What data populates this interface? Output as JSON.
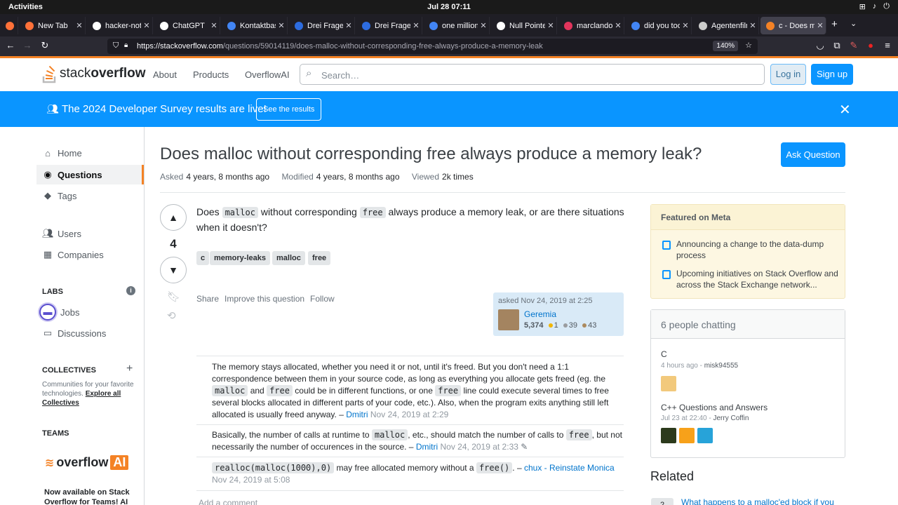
{
  "system": {
    "activities": "Activities",
    "clock": "Jul 28  07:11"
  },
  "tabs": [
    {
      "title": "",
      "color": "#ff7139"
    },
    {
      "title": "New Tab",
      "color": "#ff7139"
    },
    {
      "title": "hacker-note",
      "color": "#ffffff"
    },
    {
      "title": "ChatGPT",
      "color": "#ffffff"
    },
    {
      "title": "Kontaktbasi",
      "color": "#4285f4"
    },
    {
      "title": "Drei Fragen u",
      "color": "#2d6cdf"
    },
    {
      "title": "Drei Fragen u",
      "color": "#2d6cdf"
    },
    {
      "title": "one million d",
      "color": "#4285f4"
    },
    {
      "title": "Null Pointer E",
      "color": "#ffffff"
    },
    {
      "title": "marclandolt",
      "color": "#e2355c"
    },
    {
      "title": "did you took",
      "color": "#4285f4"
    },
    {
      "title": "Agentenfilme",
      "color": "#cccccc"
    },
    {
      "title": "c - Does mall",
      "color": "#f48225"
    }
  ],
  "browser": {
    "url_host": "https://stackoverflow.com",
    "url_path": "/questions/59014119/does-malloc-without-corresponding-free-always-produce-a-memory-leak",
    "zoom": "140%"
  },
  "header": {
    "logo_a": "stack",
    "logo_b": "overflow",
    "nav": [
      "About",
      "Products",
      "OverflowAI"
    ],
    "search_placeholder": "Search…",
    "login": "Log in",
    "signup": "Sign up"
  },
  "banner": {
    "text": "The 2024 Developer Survey results are live!",
    "button": "See the results"
  },
  "leftnav": {
    "home": "Home",
    "questions": "Questions",
    "tags": "Tags",
    "users": "Users",
    "companies": "Companies",
    "labs": "LABS",
    "jobs": "Jobs",
    "discussions": "Discussions",
    "collectives": "COLLECTIVES",
    "coll_desc": "Communities for your favorite technologies.",
    "coll_link": "Explore all Collectives",
    "teams": "TEAMS",
    "teams_logo": "overflow",
    "teams_logo_ai": "AI",
    "teams_text": "Now available on Stack Overflow for Teams! AI"
  },
  "question": {
    "title": "Does malloc without corresponding free always produce a memory leak?",
    "ask_button": "Ask Question",
    "asked_label": "Asked",
    "asked": "4 years, 8 months ago",
    "modified_label": "Modified",
    "modified": "4 years, 8 months ago",
    "viewed_label": "Viewed",
    "viewed": "2k times",
    "votes": "4",
    "body_1": "Does ",
    "code_1": "malloc",
    "body_2": " without corresponding ",
    "code_2": "free",
    "body_3": " always produce a memory leak, or are there situations when it doesn't?",
    "tags": [
      "c",
      "memory-leaks",
      "malloc",
      "free"
    ],
    "menu": [
      "Share",
      "Improve this question",
      "Follow"
    ],
    "asked_card": "asked Nov 24, 2019 at 2:25",
    "user": "Geremia",
    "rep": "5,374",
    "gold": "1",
    "silver": "39",
    "bronze": "43"
  },
  "comments": [
    {
      "t1": "The memory stays allocated, whether you need it or not, until it's freed. But you don't need a 1:1 correspondence between them in your source code, as long as everything you allocate gets freed (eg. the ",
      "c1": "malloc",
      "t2": " and ",
      "c2": "free",
      "t3": " could be in different functions, or one ",
      "c3": "free",
      "t4": " line could execute several times to free several blocks allocated in different parts of your code, etc.). Also, when the program exits anything still left allocated is usually freed anyway. – ",
      "user": "Dmitri",
      "date": "Nov 24, 2019 at 2:29"
    },
    {
      "t1": "Basically, the number of calls at runtime to ",
      "c1": "malloc",
      "t2": ", etc., should match the number of calls to ",
      "c2": "free",
      "t3": ", but not necessarily the number of occurences in the source. – ",
      "user": "Dmitri",
      "date": "Nov 24, 2019 at 2:33"
    },
    {
      "c1": "realloc(malloc(1000),0)",
      "t1": " may free allocated memory without a ",
      "c2": "free()",
      "t2": ". – ",
      "user": "chux - Reinstate Monica",
      "date": "Nov 24, 2019 at 5:08"
    }
  ],
  "add_comment": "Add a comment",
  "sidebar": {
    "featured_title": "Featured on Meta",
    "featured": [
      "Announcing a change to the data-dump process",
      "Upcoming initiatives on Stack Overflow and across the Stack Exchange network..."
    ],
    "chat_title": "6 people chatting",
    "rooms": [
      {
        "name": "C",
        "time": "4 hours ago",
        "user": "misk94555"
      },
      {
        "name": "C++ Questions and Answers",
        "time": "Jul 23 at 22:40",
        "user": "Jerry Coffin"
      }
    ],
    "related_title": "Related",
    "related_1": "What happens to a malloc'ed block if you",
    "related_1_votes": "2"
  },
  "colors": {
    "accent": "#f48225",
    "primary": "#0a95ff",
    "link": "#0074cc"
  }
}
